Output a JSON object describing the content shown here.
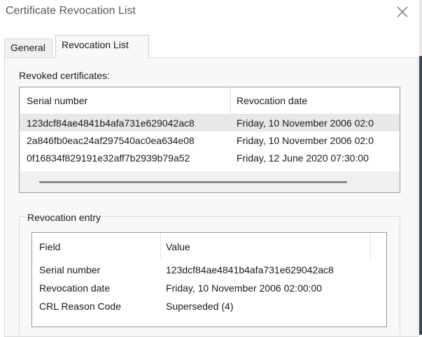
{
  "window": {
    "title": "Certificate Revocation List"
  },
  "tabs": [
    {
      "label": "General",
      "selected": false
    },
    {
      "label": "Revocation List",
      "selected": true
    }
  ],
  "revoked": {
    "label": "Revoked certificates:",
    "columns": [
      "Serial number",
      "Revocation date"
    ],
    "rows": [
      {
        "serial": "123dcf84ae4841b4afa731e629042ac8",
        "date": "Friday, 10 November 2006 02:0",
        "selected": true
      },
      {
        "serial": "2a846fb0eac24af297540ac0ea634e08",
        "date": "Friday, 10 November 2006 02:0",
        "selected": false
      },
      {
        "serial": "0f16834f829191e32aff7b2939b79a52",
        "date": "Friday, 12 June 2020 07:30:00",
        "selected": false
      }
    ]
  },
  "entry": {
    "label": "Revocation entry",
    "columns": [
      "Field",
      "Value"
    ],
    "rows": [
      {
        "field": "Serial number",
        "value": "123dcf84ae4841b4afa731e629042ac8"
      },
      {
        "field": "Revocation date",
        "value": "Friday, 10 November 2006 02:00:00"
      },
      {
        "field": "CRL Reason Code",
        "value": "Superseded (4)"
      }
    ]
  },
  "icons": {
    "close": "close-icon"
  },
  "colors": {
    "selected_row": "#e8e8e8",
    "panel": "#f8f8f8"
  }
}
